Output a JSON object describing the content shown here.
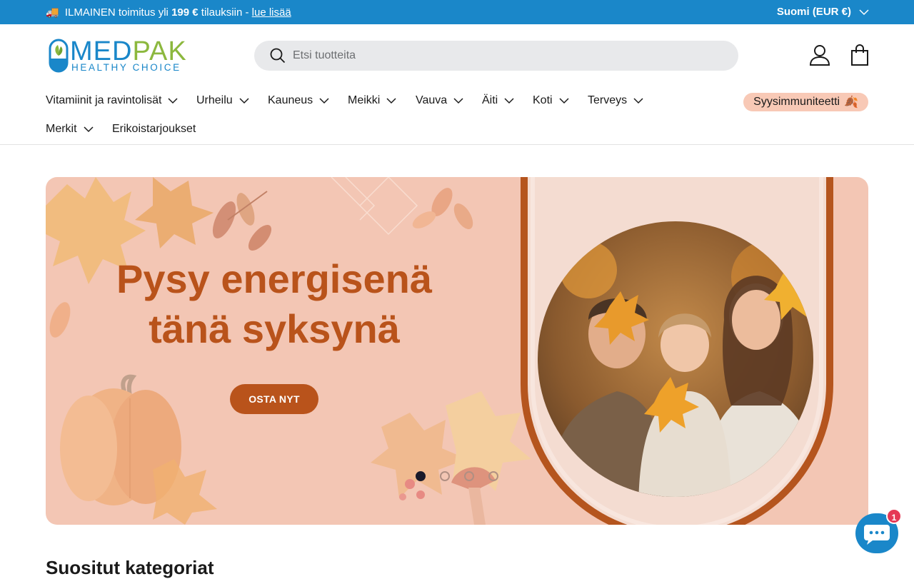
{
  "announcement": {
    "truck_icon": "🚚",
    "prefix": "ILMAINEN toimitus yli",
    "amount": "199 €",
    "suffix": "tilauksiin -",
    "link": "lue lisää",
    "locale": "Suomi (EUR €)"
  },
  "brand": {
    "name_part1": "MED",
    "name_part2": "PAK",
    "tagline": "HEALTHY CHOICE",
    "colors": {
      "blue": "#1a87c9",
      "green": "#8cb83e"
    }
  },
  "search": {
    "placeholder": "Etsi tuotteita"
  },
  "header_icons": [
    "account-icon",
    "bag-icon"
  ],
  "nav": {
    "items": [
      {
        "label": "Vitamiinit ja ravintolisät",
        "has_menu": true
      },
      {
        "label": "Urheilu",
        "has_menu": true
      },
      {
        "label": "Kauneus",
        "has_menu": true
      },
      {
        "label": "Meikki",
        "has_menu": true
      },
      {
        "label": "Vauva",
        "has_menu": true
      },
      {
        "label": "Äiti",
        "has_menu": true
      },
      {
        "label": "Koti",
        "has_menu": true
      },
      {
        "label": "Terveys",
        "has_menu": true
      },
      {
        "label": "Merkit",
        "has_menu": true
      },
      {
        "label": "Erikoistarjoukset",
        "has_menu": false
      }
    ],
    "promo": {
      "label": "Syysimmuniteetti",
      "emoji": "🍂"
    }
  },
  "hero": {
    "title_line1": "Pysy energisenä",
    "title_line2": "tänä syksynä",
    "cta": "OSTA NYT",
    "slides": 4,
    "active_slide": 1,
    "colors": {
      "accent": "#b9531b",
      "background": "#f3c6b4"
    }
  },
  "section": {
    "title": "Suositut kategoriat"
  },
  "chat": {
    "badge": "1"
  }
}
